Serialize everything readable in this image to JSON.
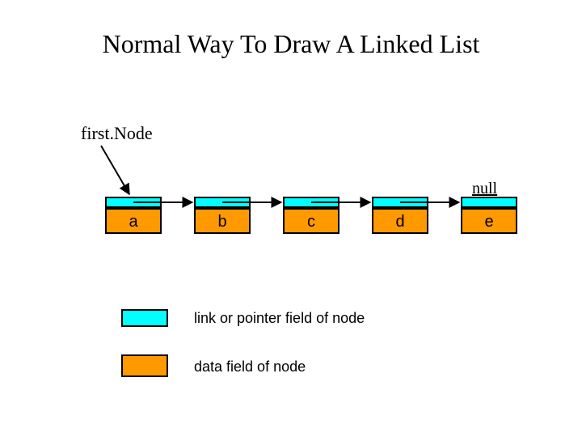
{
  "title": "Normal Way To Draw A Linked List",
  "labels": {
    "firstNode": "first.Node",
    "nullTerminator": "null"
  },
  "nodes": [
    "a",
    "b",
    "c",
    "d",
    "e"
  ],
  "legend": {
    "link": "link or pointer field of node",
    "data": "data field of node"
  },
  "colors": {
    "link": "#00ffff",
    "data": "#ff9900",
    "border": "#000000"
  }
}
